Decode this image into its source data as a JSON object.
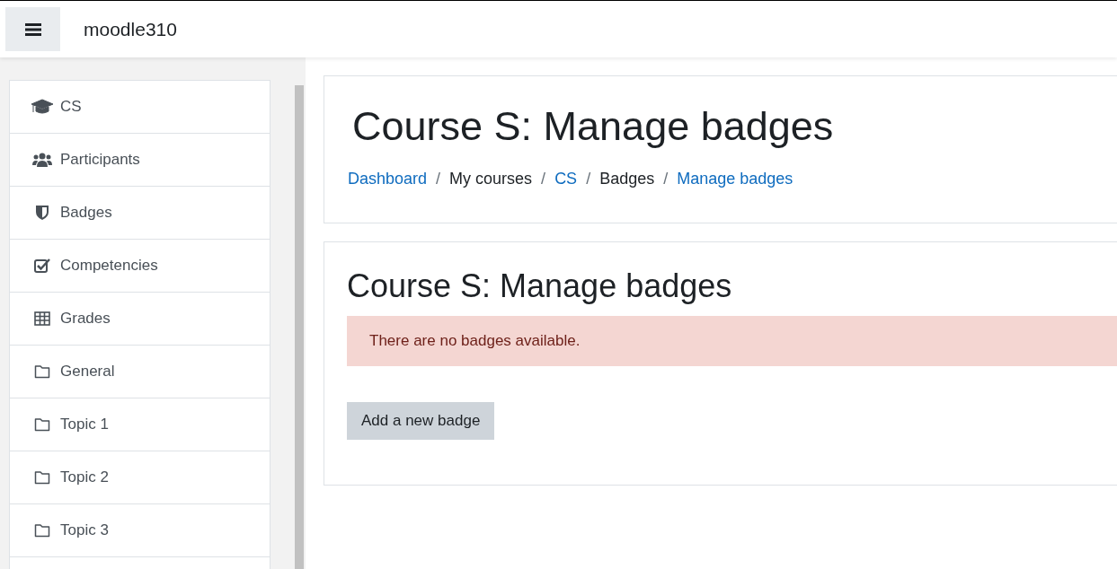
{
  "navbar": {
    "site_name": "moodle310"
  },
  "sidebar": {
    "items": [
      {
        "label": "CS",
        "kind": "course"
      },
      {
        "label": "Participants",
        "kind": "participants"
      },
      {
        "label": "Badges",
        "kind": "badges"
      },
      {
        "label": "Competencies",
        "kind": "competencies"
      },
      {
        "label": "Grades",
        "kind": "grades"
      },
      {
        "label": "General",
        "kind": "section"
      },
      {
        "label": "Topic 1",
        "kind": "section"
      },
      {
        "label": "Topic 2",
        "kind": "section"
      },
      {
        "label": "Topic 3",
        "kind": "section"
      }
    ]
  },
  "header": {
    "title": "Course S: Manage badges",
    "breadcrumb": [
      {
        "label": "Dashboard",
        "kind": "link"
      },
      {
        "label": "/",
        "kind": "separator"
      },
      {
        "label": "My courses",
        "kind": "text"
      },
      {
        "label": "/",
        "kind": "separator"
      },
      {
        "label": "CS",
        "kind": "link"
      },
      {
        "label": "/",
        "kind": "separator"
      },
      {
        "label": "Badges",
        "kind": "text"
      },
      {
        "label": "/",
        "kind": "separator"
      },
      {
        "label": "Manage badges",
        "kind": "link"
      }
    ]
  },
  "content": {
    "heading": "Course S: Manage badges",
    "alert": "There are no badges available.",
    "button": "Add a new badge"
  }
}
